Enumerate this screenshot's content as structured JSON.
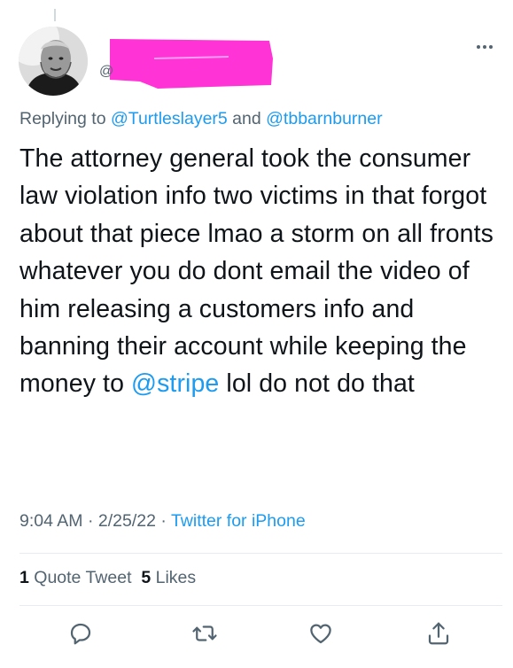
{
  "tweet": {
    "handle_prefix": "@",
    "reply_prefix": "Replying to ",
    "reply_mention_1": "@Turtleslayer5",
    "reply_conjunction": " and ",
    "reply_mention_2": "@tbbarnburner",
    "text_part1": "The attorney general took the consumer law violation info two victims in that forgot about that piece lmao a storm on all fronts whatever you do dont email the video of him releasing a customers info and banning their account while keeping the money to ",
    "text_link": "@stripe",
    "text_part2": " lol do not do that",
    "time": "9:04 AM",
    "date": "2/25/22",
    "source": "Twitter for iPhone",
    "separator": " · "
  },
  "stats": {
    "quote_count": "1",
    "quote_label": "Quote Tweet",
    "like_count": "5",
    "like_label": "Likes"
  },
  "colors": {
    "text": "#0f1419",
    "secondary": "#536471",
    "link": "#1d9bf0",
    "redaction": "#ff33d6"
  },
  "actions": {
    "icons": [
      "reply-icon",
      "retweet-icon",
      "like-icon",
      "share-icon"
    ]
  }
}
